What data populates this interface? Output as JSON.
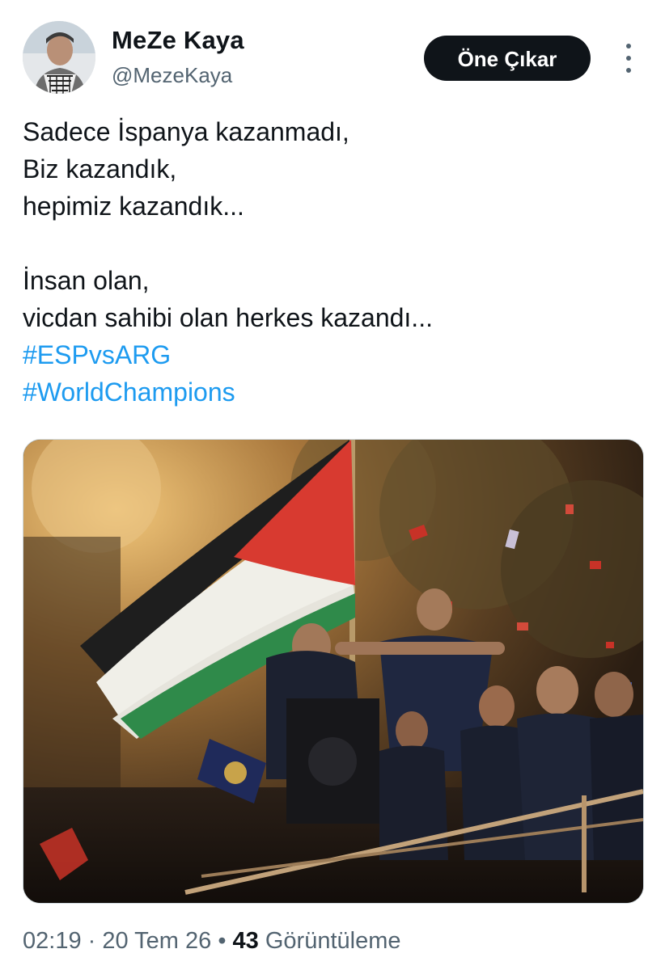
{
  "author": {
    "display_name": "MeZe Kaya",
    "handle": "@MezeKaya",
    "avatar_icon": "person-avatar-icon"
  },
  "actions": {
    "follow_label": "Öne Çıkar",
    "more_icon": "more-vertical-icon"
  },
  "tweet": {
    "lines": [
      "Sadece İspanya kazanmadı,",
      "Biz kazandık,",
      "hepimiz kazandık...",
      "İnsan olan,",
      "vicdan sahibi olan herkes kazandı..."
    ],
    "hashtags": [
      "#ESPvsARG",
      "#WorldChampions"
    ]
  },
  "meta": {
    "time": "02:19",
    "separator": "·",
    "date": "20 Tem 26",
    "dot": "•",
    "views_count": "43",
    "views_label": "Görüntüleme"
  },
  "colors": {
    "text": "#0f1419",
    "secondary": "#536471",
    "link": "#1d9bf0",
    "button_bg": "#0f1419"
  }
}
